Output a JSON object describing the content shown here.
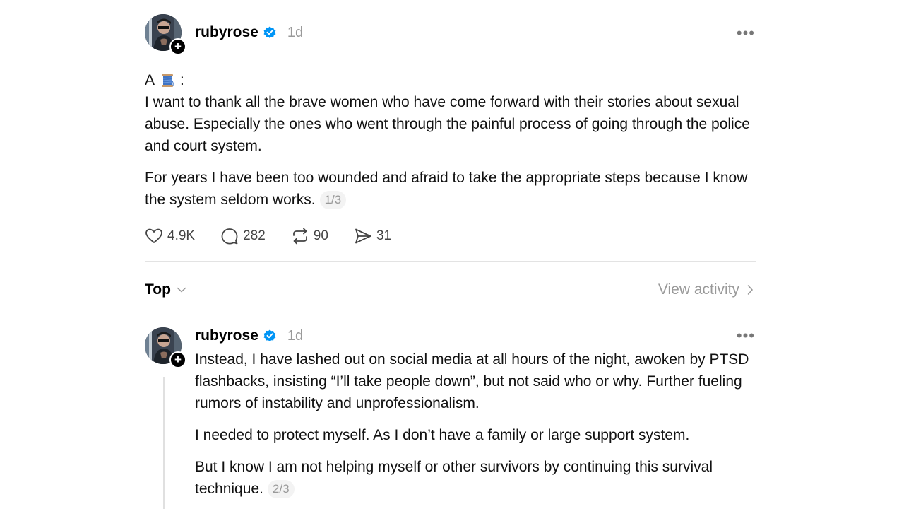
{
  "post": {
    "username": "rubyrose",
    "time": "1d",
    "more_label": "•••",
    "intro_letter": "A",
    "intro_suffix": ":",
    "paragraphs": [
      "I want to thank all the brave women who have come forward with their stories about sexual abuse. Especially the ones who went through the painful process of going through the police and court system.",
      "For years I have been too wounded and afraid to take the appropriate steps because I know the system seldom works."
    ],
    "thread_count": "1/3",
    "actions": {
      "likes": "4.9K",
      "replies": "282",
      "reposts": "90",
      "shares": "31"
    }
  },
  "sort": {
    "label": "Top",
    "view_activity": "View activity"
  },
  "reply": {
    "username": "rubyrose",
    "time": "1d",
    "more_label": "•••",
    "paragraphs": [
      "Instead, I have lashed out on social media at all hours of the night, awoken by PTSD flashbacks, insisting “I’ll take people down”, but not said who or why. Further fueling rumors of instability and unprofessionalism.",
      "I needed to protect myself. As I don’t have a family or large support system.",
      "But I know I am not helping myself or other survivors by continuing this survival technique."
    ],
    "thread_count": "2/3"
  },
  "icons": {
    "verified": "verified-badge-icon",
    "spool": "thread-spool-emoji",
    "like": "heart-icon",
    "reply": "comment-icon",
    "repost": "repost-icon",
    "share": "send-icon",
    "follow": "plus-icon",
    "more": "more-icon",
    "chevron_down": "chevron-down-icon",
    "chevron_right": "chevron-right-icon"
  },
  "colors": {
    "verified_blue": "#0095f6",
    "muted_text": "#999999",
    "divider": "#e3e3e3"
  }
}
